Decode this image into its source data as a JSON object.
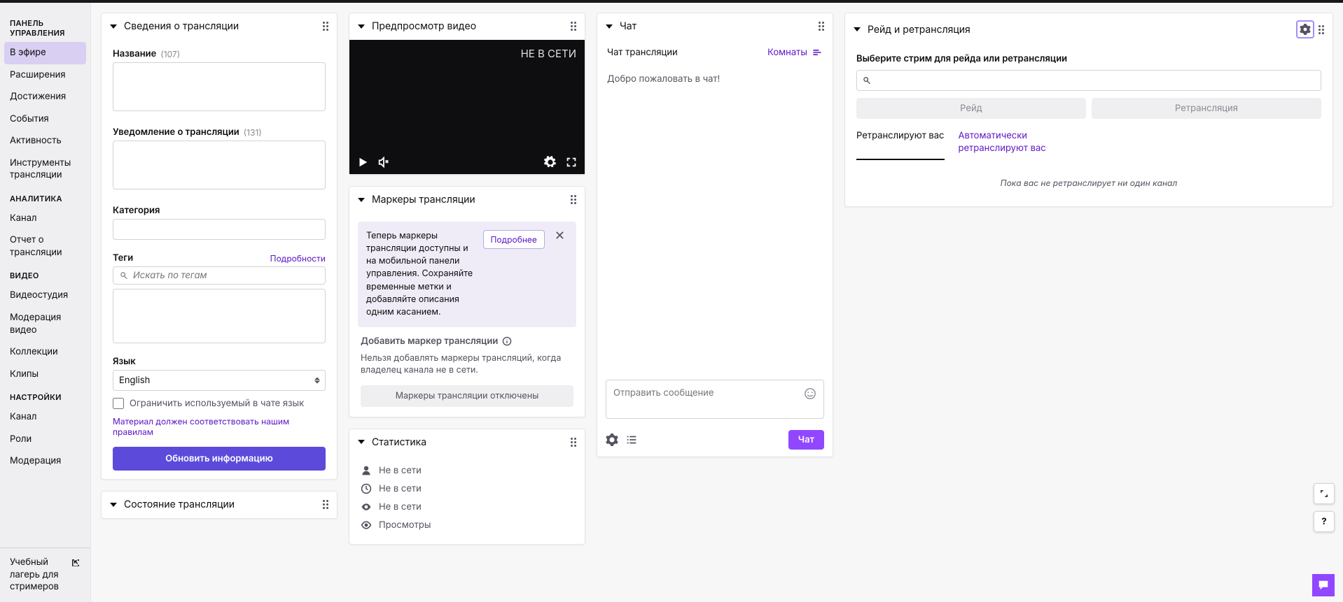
{
  "sidebar": {
    "header1": "ПАНЕЛЬ УПРАВЛЕНИЯ",
    "items1": [
      "В эфире",
      "Расширения",
      "Достижения",
      "События",
      "Активность",
      "Инструменты трансляции"
    ],
    "header2": "АНАЛИТИКА",
    "items2": [
      "Канал",
      "Отчет о трансляции"
    ],
    "header3": "ВИДЕО",
    "items3": [
      "Видеостудия",
      "Модерация видео",
      "Коллекции",
      "Клипы"
    ],
    "header4": "НАСТРОЙКИ",
    "items4": [
      "Канал",
      "Роли",
      "Модерация"
    ],
    "footer": "Учебный лагерь для стримеров"
  },
  "streamInfo": {
    "title": "Сведения о трансляции",
    "name_label": "Название",
    "name_count": "(107)",
    "notify_label": "Уведомление о трансляции",
    "notify_count": "(131)",
    "category_label": "Категория",
    "tags_label": "Теги",
    "tags_more": "Подробности",
    "tags_placeholder": "Искать по тегам",
    "lang_label": "Язык",
    "lang_value": "English",
    "limit_label": "Ограничить используемый в чате язык",
    "rules": "Материал должен соответствовать нашим правилам",
    "update_btn": "Обновить информацию"
  },
  "streamHealth": {
    "title": "Состояние трансляции"
  },
  "preview": {
    "title": "Предпросмотр видео",
    "offline": "НЕ В СЕТИ"
  },
  "markers": {
    "title": "Маркеры трансляции",
    "banner": "Теперь маркеры трансляции доступны и на мобильной панели управления. Сохраняйте временные метки и добавляйте описания одним касанием.",
    "more": "Подробнее",
    "add_label": "Добавить маркер трансляции",
    "desc": "Нельзя добавлять маркеры трансляций, когда владелец канала не в сети.",
    "disabled_btn": "Маркеры трансляции отключены"
  },
  "stats": {
    "title": "Статистика",
    "rows": [
      "Не в сети",
      "Не в сети",
      "Не в сети",
      "Просмотры"
    ]
  },
  "chat": {
    "title": "Чат",
    "hd_left": "Чат трансляции",
    "hd_right": "Комнаты",
    "welcome": "Добро пожаловать в чат!",
    "input_ph": "Отправить сообщение",
    "send": "Чат"
  },
  "raid": {
    "title": "Рейд и ретрансляция",
    "search_label": "Выберите стрим для рейда или ретрансляции",
    "btn1": "Рейд",
    "btn2": "Ретрансляция",
    "tab1": "Ретранслируют вас",
    "tab2": "Автоматически ретранслируют вас",
    "empty": "Пока вас не ретранслирует ни один канал"
  }
}
